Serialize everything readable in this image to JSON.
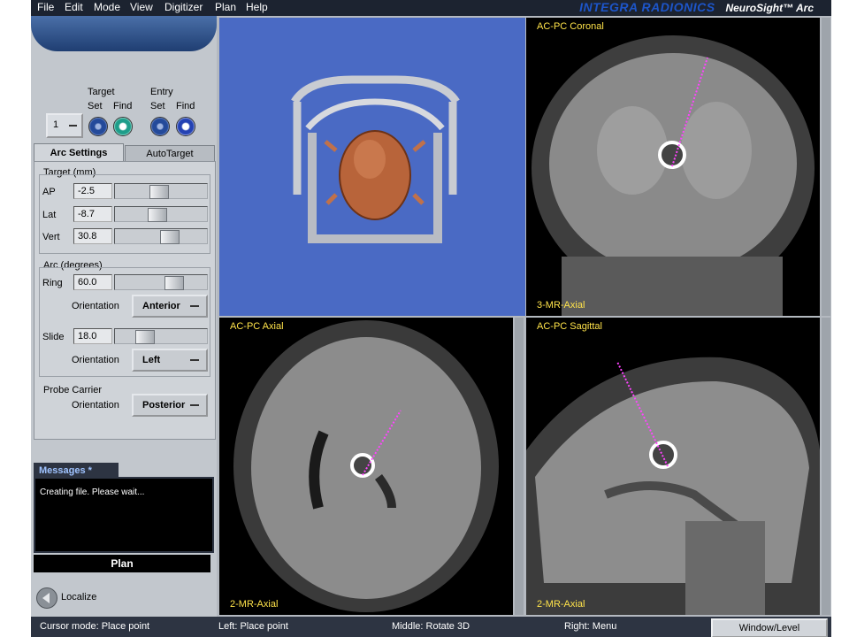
{
  "menu": [
    "File",
    "Edit",
    "Mode",
    "View",
    "Digitizer",
    "Plan",
    "Help"
  ],
  "brand": {
    "company": "INTEGRA RADIONICS",
    "product": "NeuroSight™ Arc"
  },
  "target_entry": {
    "target_label": "Target",
    "entry_label": "Entry",
    "set_label": "Set",
    "find_label": "Find",
    "index_value": "1"
  },
  "tabs": {
    "arc_settings": "Arc Settings",
    "autotarget": "AutoTarget"
  },
  "target_group": {
    "title": "Target (mm)",
    "ap_label": "AP",
    "ap_value": "-2.5",
    "lat_label": "Lat",
    "lat_value": "-8.7",
    "vert_label": "Vert",
    "vert_value": "30.8"
  },
  "arc_group": {
    "title": "Arc (degrees)",
    "ring_label": "Ring",
    "ring_value": "60.0",
    "orientation_label": "Orientation",
    "ring_orientation": "Anterior",
    "slide_label": "Slide",
    "slide_value": "18.0",
    "slide_orientation": "Left"
  },
  "probe_carrier": {
    "title": "Probe Carrier",
    "orientation_label": "Orientation",
    "orientation": "Posterior"
  },
  "messages": {
    "tab": "Messages *",
    "text": "Creating file.  Please wait..."
  },
  "plan_button": "Plan",
  "localize_button": "Localize",
  "views": {
    "coronal": {
      "label": "AC-PC Coronal",
      "series": "3-MR-Axial"
    },
    "axial": {
      "label": "AC-PC Axial",
      "series": "2-MR-Axial"
    },
    "sagittal": {
      "label": "AC-PC Sagittal",
      "series": "2-MR-Axial"
    }
  },
  "status": {
    "cursor_mode": "Cursor mode: Place point",
    "left": "Left: Place point",
    "middle": "Middle: Rotate 3D",
    "right": "Right: Menu",
    "window_level": "Window/Level"
  },
  "slider_levels": {
    "ap": 0.48,
    "lat": 0.45,
    "vert": 0.62,
    "ring": 0.68,
    "slide": 0.28
  },
  "colors": {
    "accent_yellow": "#ffe34a",
    "trajectory": "#ff44ff",
    "viewport_3d": "#4a6ac4"
  }
}
